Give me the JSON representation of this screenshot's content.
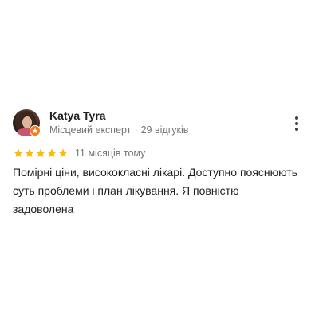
{
  "review": {
    "author": {
      "name": "Katya Tyra",
      "badge": "Місцевий експерт",
      "separator": "·",
      "review_count": "29 відгуків"
    },
    "rating": {
      "stars": 5,
      "max": 5,
      "color": "#fbbc04"
    },
    "time": "11 місяців тому",
    "text": "Помірні ціни, висококласні лікарі. Доступно пояснюють суть проблеми і план лікування. Я повністю задоволена"
  },
  "colors": {
    "guide_badge": "#f4791f",
    "text_primary": "#202124",
    "text_secondary": "#70757a"
  }
}
